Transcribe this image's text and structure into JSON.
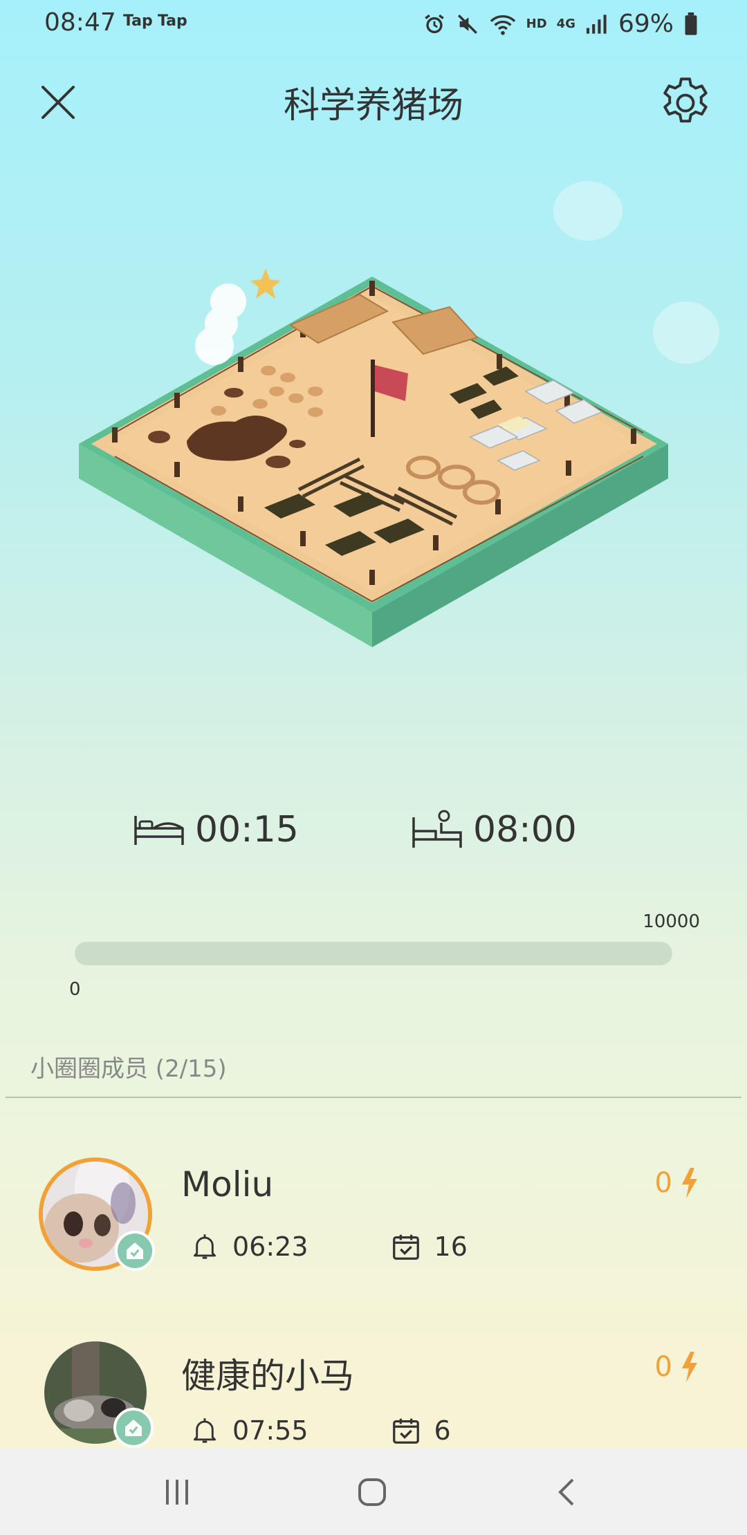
{
  "status_bar": {
    "time": "08:47",
    "notif_1": "Tap",
    "notif_2": "Tap",
    "network": "4G",
    "hd": "HD",
    "battery": "69%"
  },
  "header": {
    "title": "科学养猪场"
  },
  "sleep": {
    "bedtime": "00:15",
    "waketime": "08:00"
  },
  "progress": {
    "min_label": "0",
    "max_label": "10000",
    "fraction": 0
  },
  "members": {
    "title": "小圈圈成员 (2/15)",
    "items": [
      {
        "name": "Moliu",
        "energy": "0",
        "alarm": "06:23",
        "days": "16"
      },
      {
        "name": "健康的小马",
        "energy": "0",
        "alarm": "07:55",
        "days": "6"
      }
    ]
  },
  "colors": {
    "accent_orange": "#f0a13a",
    "badge_green": "#86c9ae",
    "progress_track": "#cbdcc8"
  },
  "icons": [
    "close-icon",
    "gear-icon",
    "bed-icon",
    "wake-up-icon",
    "bell-icon",
    "calendar-check-icon",
    "lightning-icon",
    "home-check-icon"
  ]
}
